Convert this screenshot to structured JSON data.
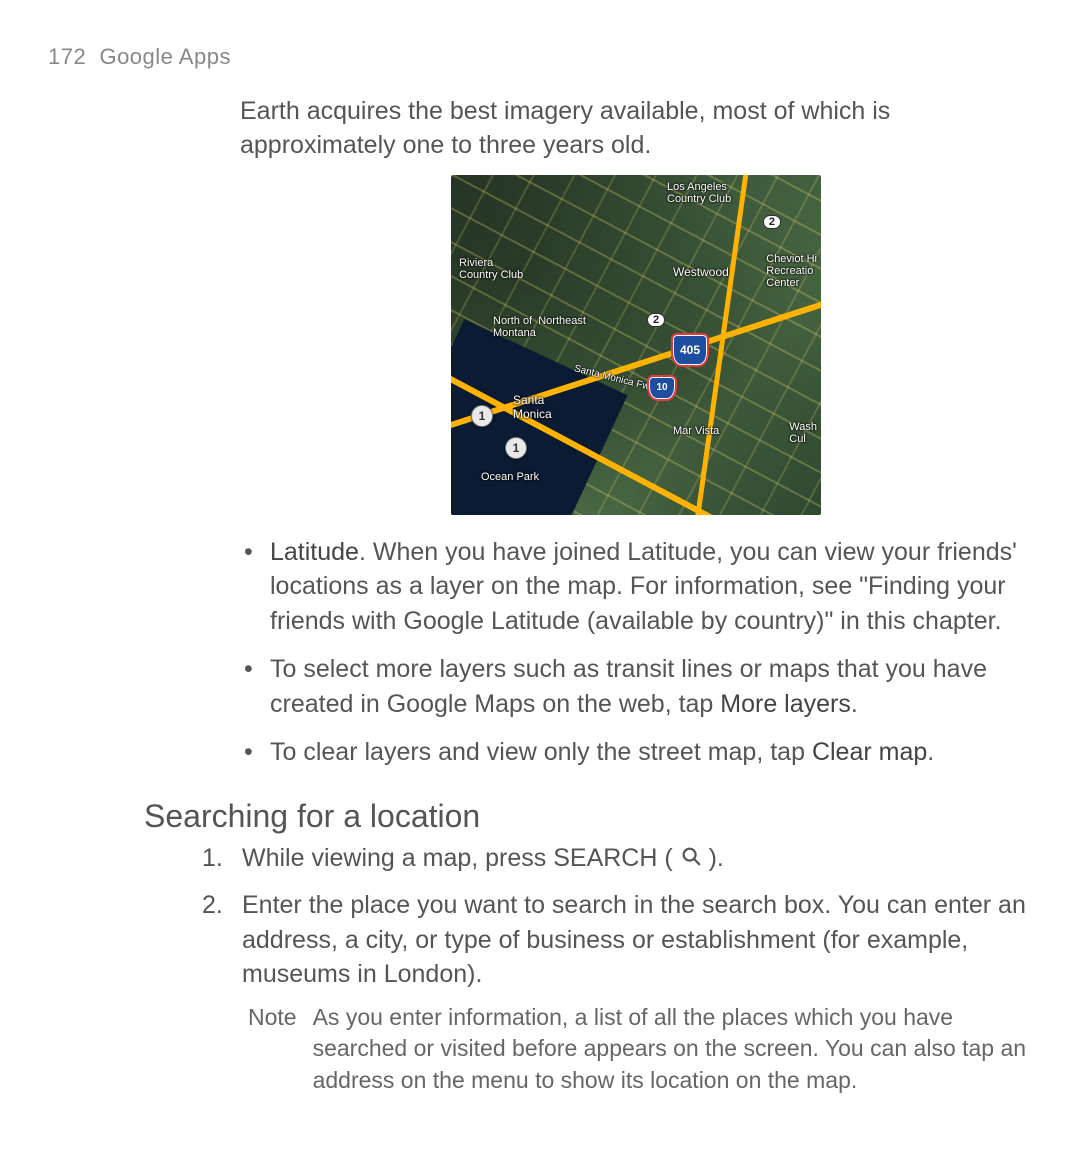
{
  "running_head": {
    "page_no": "172",
    "title": "Google Apps"
  },
  "intro": "Earth acquires the best imagery available, most of which is approximately one to three years old.",
  "map_labels": {
    "la_cc": "Los Angeles\nCountry Club",
    "westwood": "Westwood",
    "cheviot": "Cheviot Hi\nRecreatio\nCenter",
    "riviera": "Riviera\nCountry Club",
    "north_ne_montana": "North of  Northeast\nMontana",
    "santa_monica": "Santa\nMonica",
    "mar_vista": "Mar Vista",
    "wash_cul": "Wash\nCul",
    "ocean_park": "Ocean Park",
    "sm_fwy": "Santa Monica Fwy",
    "shield_405": "405",
    "shield_10": "10",
    "badge_2a": "2",
    "badge_2b": "2",
    "pin_1a": "1",
    "pin_1b": "1"
  },
  "bullets": {
    "latitude_bold": "Latitude",
    "latitude_rest": ". When you have joined Latitude, you can view your friends' locations as a layer on the map. For information, see \"Finding your friends with Google Latitude (available by country)\" in this chapter.",
    "more_pre": "To select more layers such as transit lines or maps that you have created in Google Maps on the web, tap ",
    "more_bold": "More layers",
    "more_post": ".",
    "clear_pre": "To clear layers and view only the street map, tap ",
    "clear_bold": "Clear map",
    "clear_post": "."
  },
  "section_heading": "Searching for a location",
  "steps": {
    "s1_pre": "While viewing a map, press SEARCH ( ",
    "s1_post": " ).",
    "s2": "Enter the place you want to search in the search box. You can enter an address, a city, or type of business or establishment (for example, museums in London).",
    "note_label": "Note",
    "note_body": "As you enter information, a list of all the places which you have searched or visited before appears on the screen. You can also tap an address on the menu to show its location on the map."
  }
}
